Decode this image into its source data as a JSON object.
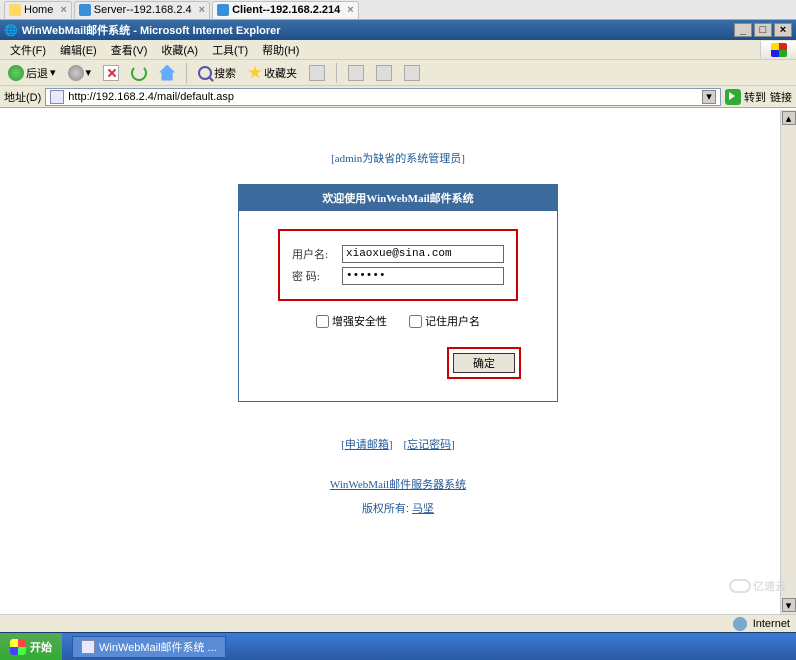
{
  "top_tabs": [
    {
      "label": "Home",
      "icon": "home"
    },
    {
      "label": "Server--192.168.2.4",
      "icon": "remote"
    },
    {
      "label": "Client--192.168.2.214",
      "icon": "remote"
    }
  ],
  "window": {
    "title": "WinWebMail邮件系统 - Microsoft Internet Explorer"
  },
  "menu": {
    "file": "文件(F)",
    "edit": "编辑(E)",
    "view": "查看(V)",
    "favorites": "收藏(A)",
    "tools": "工具(T)",
    "help": "帮助(H)"
  },
  "toolbar": {
    "back": "后退",
    "search": "搜索",
    "favorites": "收藏夹"
  },
  "address": {
    "label": "地址(D)",
    "url": "http://192.168.2.4/mail/default.asp",
    "go": "转到",
    "links": "链接"
  },
  "page": {
    "admin_note": "[admin为缺省的系统管理员]",
    "panel_title": "欢迎使用WinWebMail邮件系统",
    "username_label": "用户名:",
    "username_value": "xiaoxue@sina.com",
    "password_label": "密  码:",
    "password_value": "••••••",
    "enhance_label": "增强安全性",
    "remember_label": "记住用户名",
    "ok_label": "确定",
    "apply_label": "申请邮箱",
    "forgot_label": "忘记密码",
    "footer_product": "WinWebMail邮件服务器系统",
    "footer_copy_prefix": "版权所有: ",
    "footer_copy_name": "马坚"
  },
  "status": {
    "zone": "Internet"
  },
  "taskbar": {
    "start": "开始",
    "task1": "WinWebMail邮件系统 ..."
  },
  "watermark": "亿速云"
}
